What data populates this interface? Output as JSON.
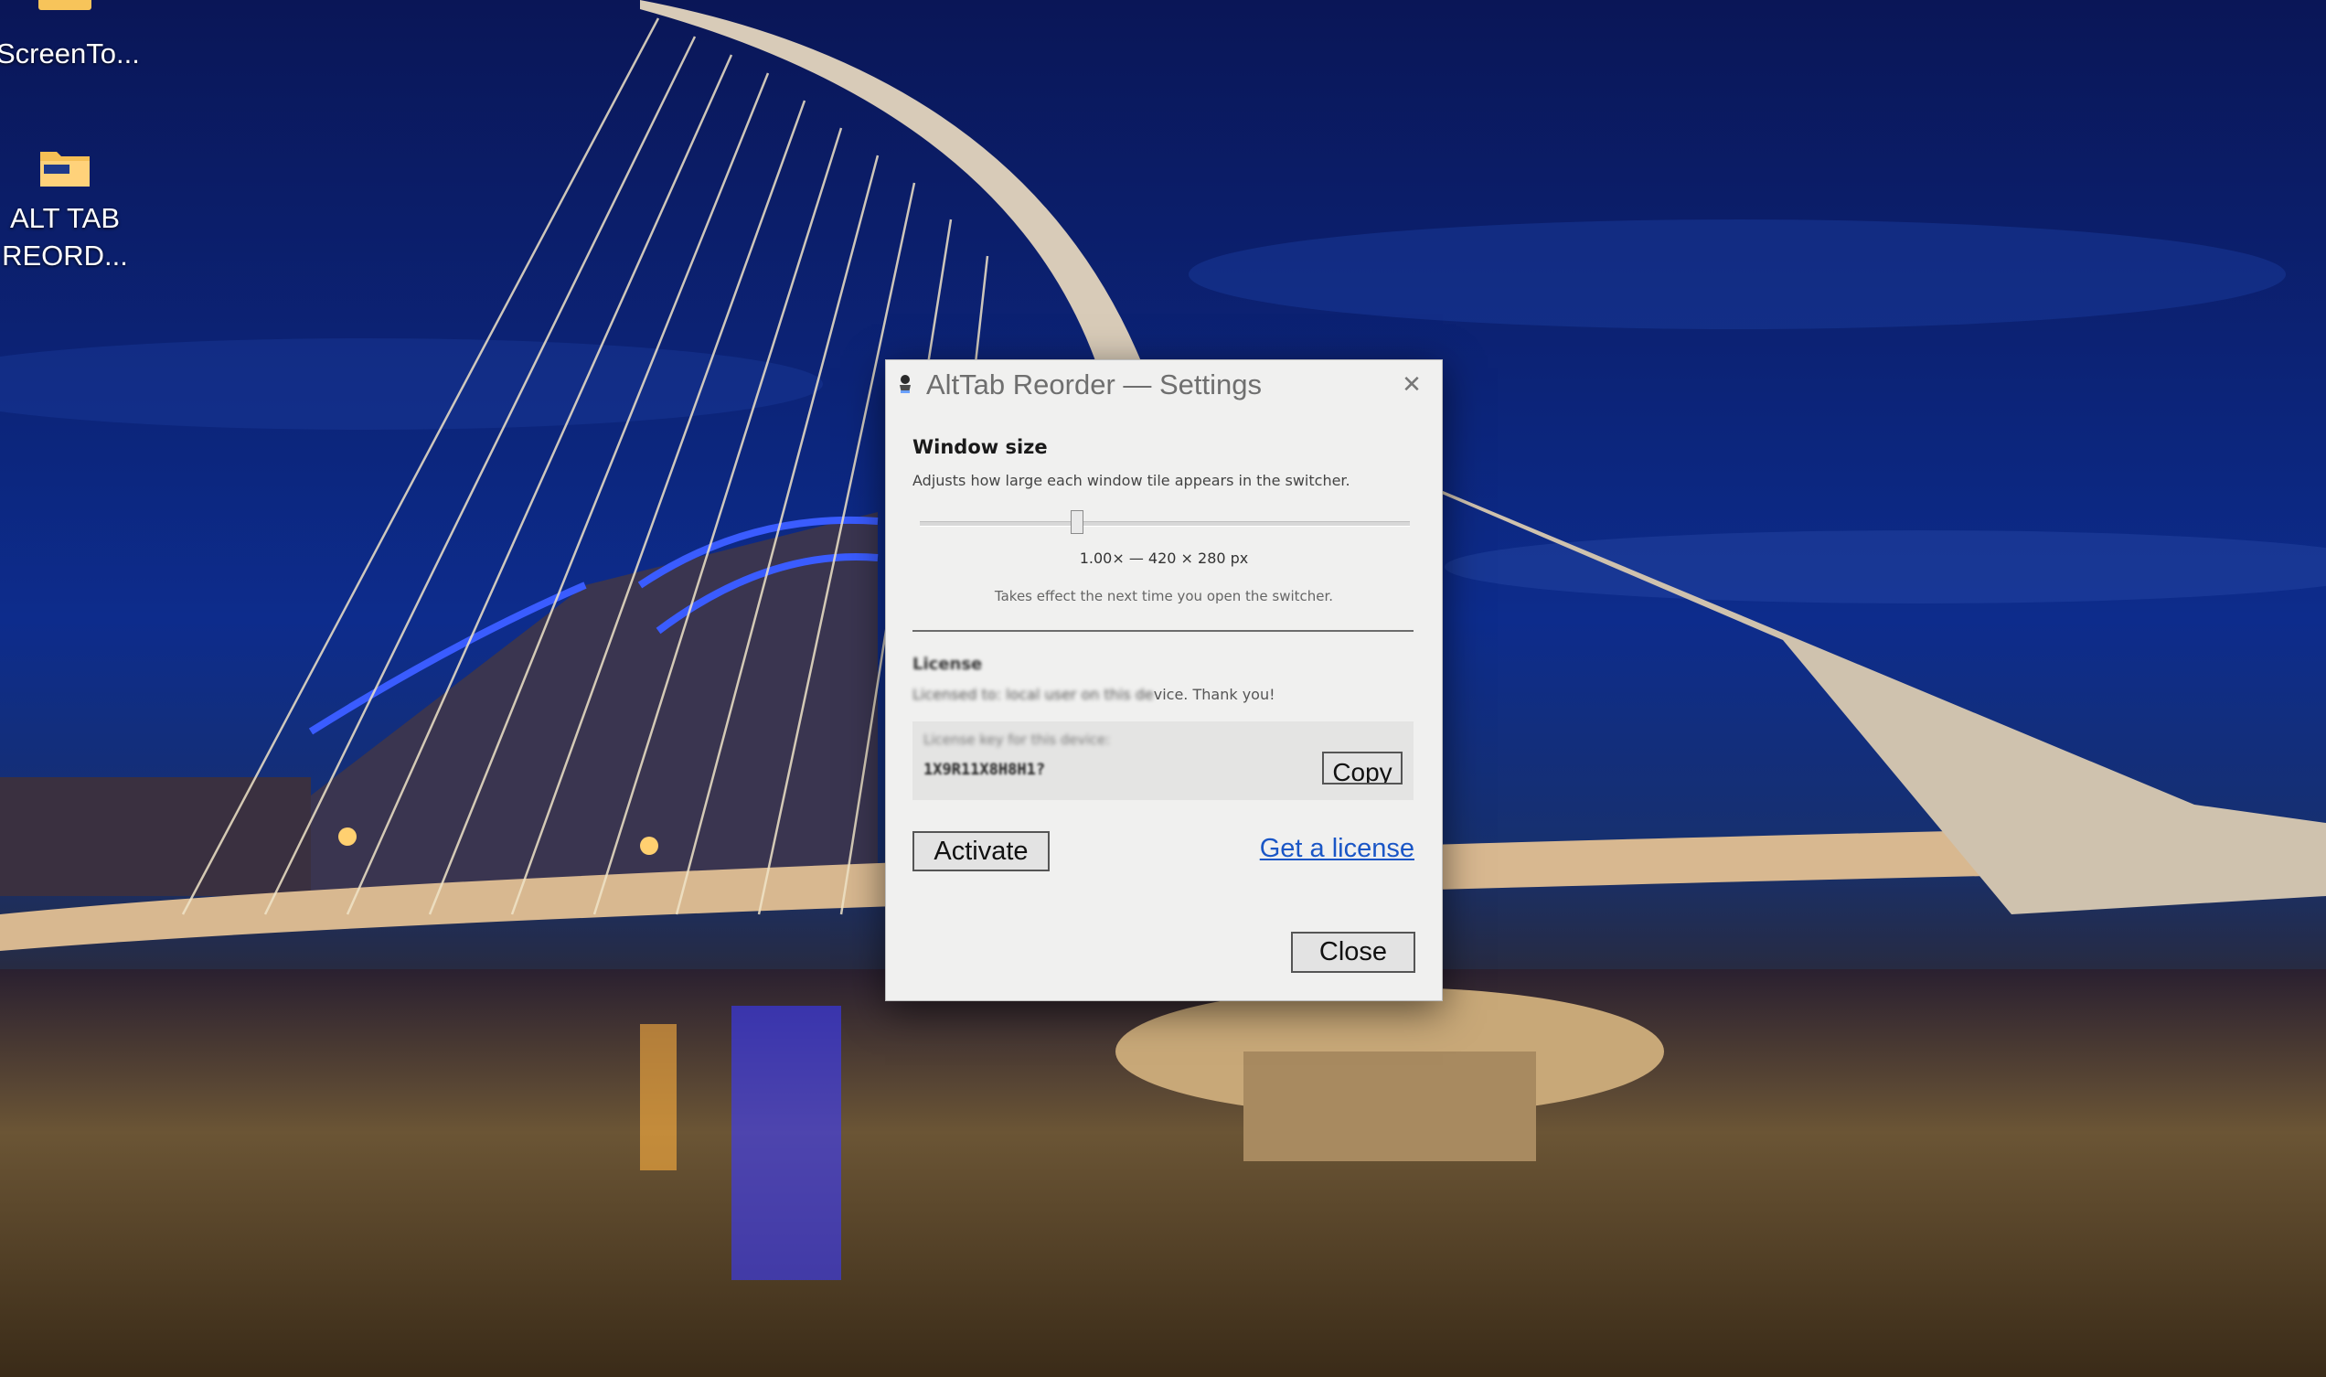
{
  "desktop": {
    "icons": [
      {
        "label": "ScreenTo..."
      },
      {
        "label_line1": "ALT TAB",
        "label_line2": "REORD..."
      }
    ]
  },
  "dialog": {
    "title": "AltTab Reorder — Settings",
    "close_glyph": "✕",
    "window_size": {
      "title": "Window size",
      "description": "Adjusts how large each window tile appears in the switcher.",
      "readout": "1.00×  —  420 × 280 px",
      "note": "Takes effect the next time you open the switcher.",
      "slider_position_fraction": 0.32
    },
    "license": {
      "title": "License",
      "description_visible": "vice. Thank you!",
      "description_blurred": "Licensed to: local user on this de",
      "key_label": "License key for this device:",
      "key_value": "1X9R11X8H8H1?",
      "copy_label": "Copy"
    },
    "activate_label": "Activate",
    "get_license_label": "Get a license",
    "close_label": "Close"
  }
}
